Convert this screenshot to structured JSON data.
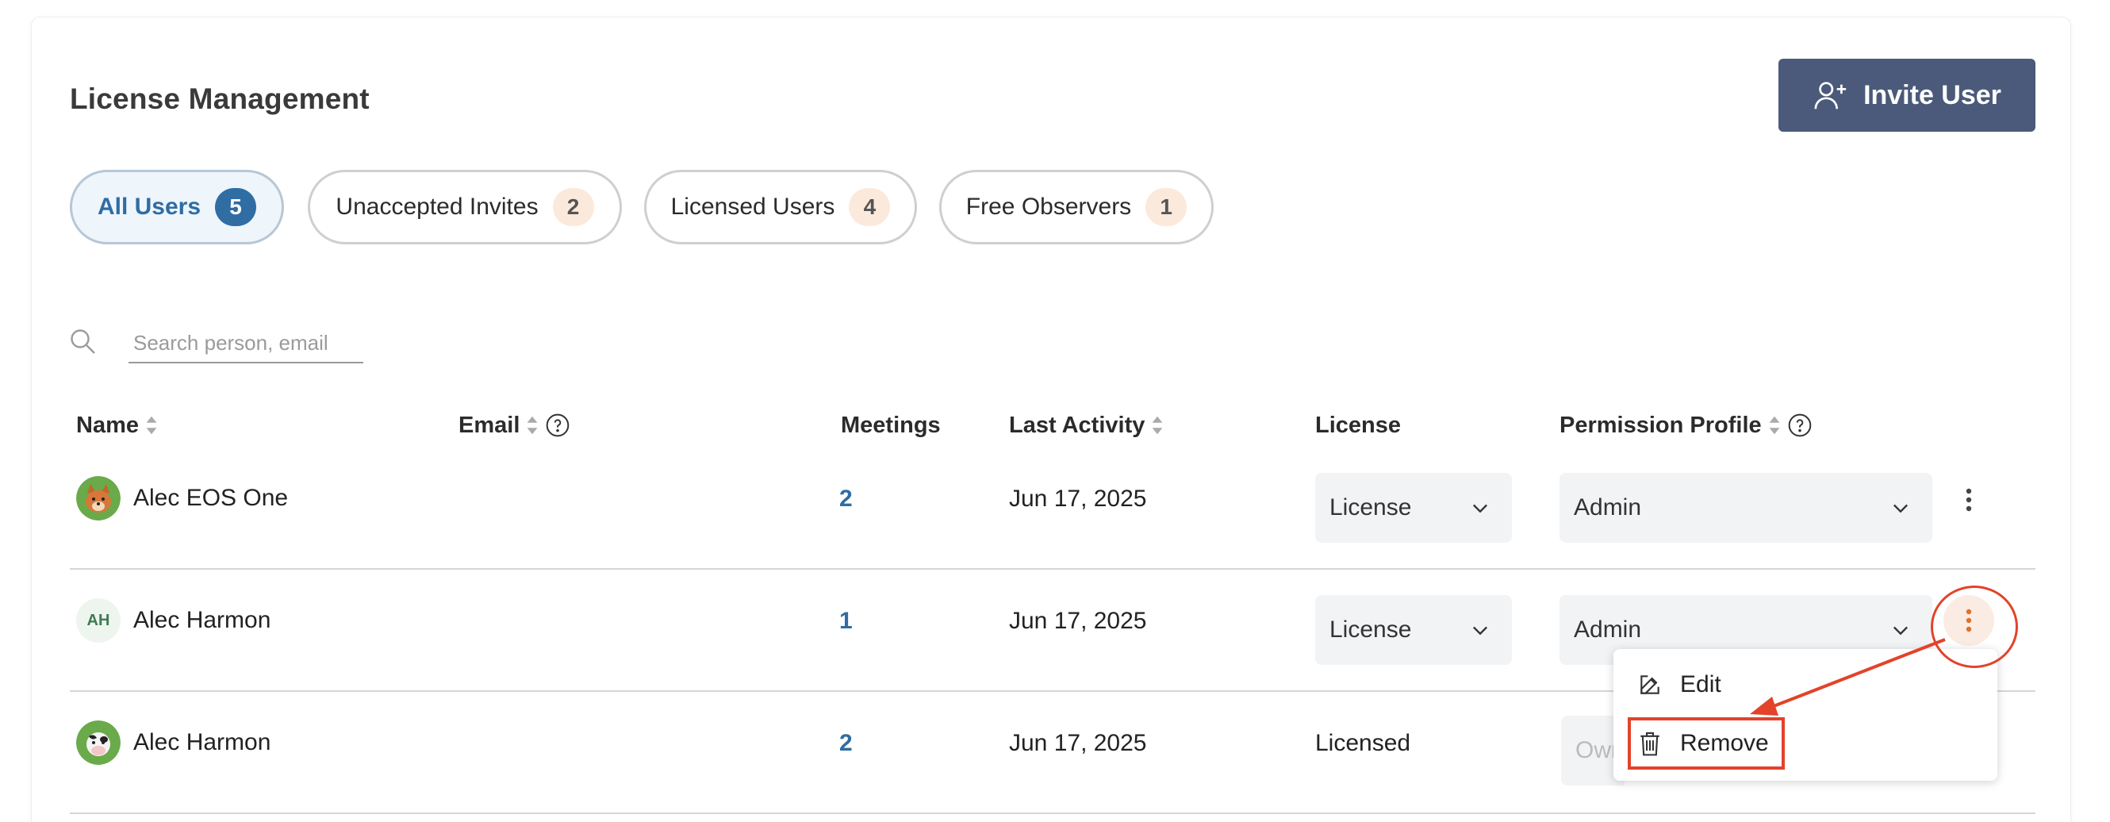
{
  "header": {
    "title": "License Management",
    "invite_label": "Invite User"
  },
  "filters": [
    {
      "label": "All Users",
      "count": "5",
      "active": true
    },
    {
      "label": "Unaccepted Invites",
      "count": "2"
    },
    {
      "label": "Licensed Users",
      "count": "4"
    },
    {
      "label": "Free Observers",
      "count": "1"
    }
  ],
  "search": {
    "placeholder": "Search person, email",
    "value": ""
  },
  "columns": {
    "name": "Name",
    "email": "Email",
    "meetings": "Meetings",
    "last_activity": "Last Activity",
    "license": "License",
    "permission": "Permission Profile"
  },
  "rows": [
    {
      "name": "Alec EOS One",
      "meetings": "2",
      "last_activity": "Jun 17, 2025",
      "license": "License",
      "permission": "Admin",
      "avatar": "fox-avatar"
    },
    {
      "name": "Alec Harmon",
      "initials": "AH",
      "meetings": "1",
      "last_activity": "Jun 17, 2025",
      "license": "License",
      "permission": "Admin",
      "avatar": "initials-avatar"
    },
    {
      "name": "Alec Harmon",
      "meetings": "2",
      "last_activity": "Jun 17, 2025",
      "license": "Licensed",
      "permission": "Owner",
      "avatar": "cow-avatar"
    }
  ],
  "row_menu": {
    "edit_label": "Edit",
    "remove_label": "Remove"
  },
  "colors": {
    "accent": "#2f6da3",
    "invite_bg": "#4b5a7a",
    "annotation": "#e2432a",
    "kebab_active": "#e0712a"
  }
}
